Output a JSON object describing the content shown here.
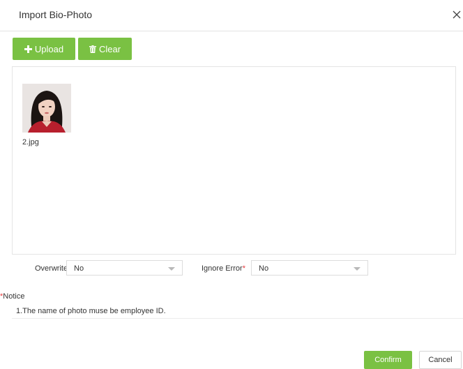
{
  "dialog": {
    "title": "Import Bio-Photo",
    "close_icon": "close-icon"
  },
  "toolbar": {
    "upload_label": "Upload",
    "upload_icon": "plus-icon",
    "clear_label": "Clear",
    "clear_icon": "trash-icon"
  },
  "photos": [
    {
      "filename": "2.jpg"
    }
  ],
  "options": {
    "overwrite_label": "Overwrite",
    "overwrite_required": "*",
    "overwrite_value": "No",
    "ignore_error_label": "Ignore Error",
    "ignore_error_required": "*",
    "ignore_error_value": "No"
  },
  "notice": {
    "required_mark": "*",
    "title": "Notice",
    "text": "1.The name of photo muse be employee ID."
  },
  "footer": {
    "confirm_label": "Confirm",
    "cancel_label": "Cancel"
  },
  "colors": {
    "accent": "#7ac143",
    "required": "#e4393c"
  }
}
